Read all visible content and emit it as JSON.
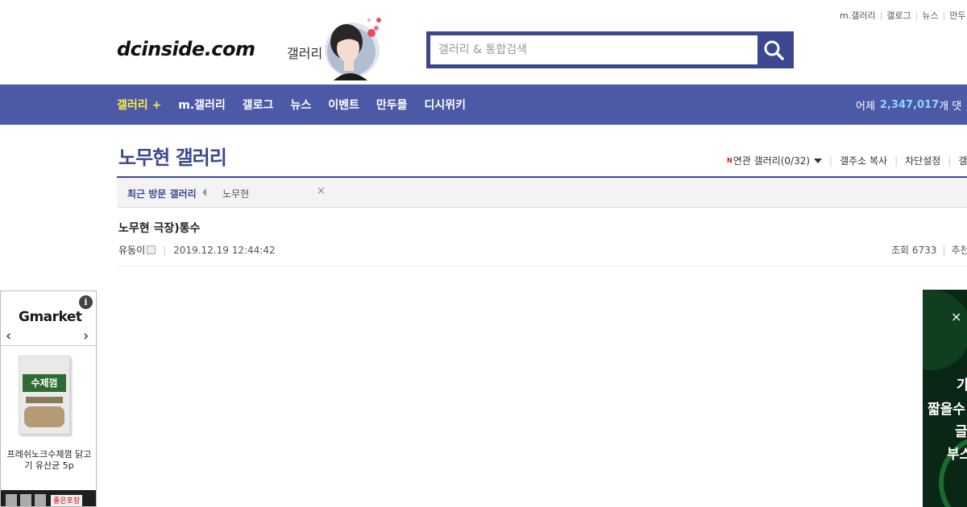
{
  "util_links": [
    "m.갤러리",
    "갤로그",
    "뉴스",
    "만두"
  ],
  "header": {
    "logo": "dcinside.com",
    "logo_sub": "갤러리",
    "search_placeholder": "갤러리 & 통합검색"
  },
  "nav": {
    "items": [
      "갤러리 +",
      "m.갤러리",
      "갤로그",
      "뉴스",
      "이벤트",
      "만두몰",
      "디시위키"
    ],
    "stats_label": "어제",
    "stats_value": "2,347,017",
    "stats_unit": "개 댓"
  },
  "gallery": {
    "title": "노무현 갤러리",
    "links": {
      "new_badge": "N",
      "related": "연관 갤러리(0/32)",
      "copy_address": "갤주소 복사",
      "block_settings": "차단설정",
      "cut": "갤러"
    },
    "recent": {
      "label": "최근 방문 갤러리",
      "item": "노무현",
      "close": "×"
    }
  },
  "post": {
    "title": "노무현 극장)통수",
    "author": "유동이",
    "date": "2019.12.19 12:44:42",
    "views": "조회 6733",
    "recommend": "추천"
  },
  "ad_left": {
    "brand": "Gmarket",
    "info": "i",
    "prev": "‹",
    "next": "›",
    "product_label": "수제껌",
    "product_name": "프레쉬노크수제껌 닭고기 유산균 5p",
    "bottom_brand": "좋은포장"
  },
  "ad_right": {
    "close": "×",
    "lines": [
      "가",
      "짧을수",
      "글",
      "부스"
    ]
  }
}
